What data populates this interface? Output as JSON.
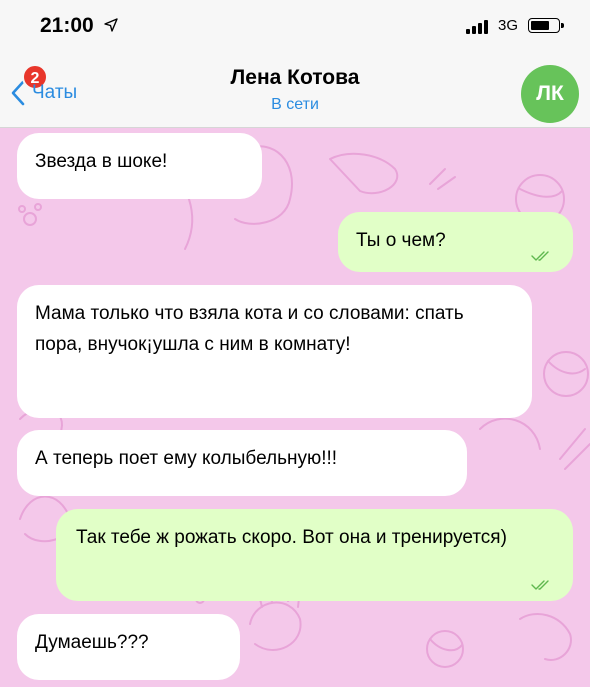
{
  "status_bar": {
    "time": "21:00",
    "network": "3G"
  },
  "nav": {
    "back_label": "Чаты",
    "unread_badge": "2",
    "title": "Лена Котова",
    "status": "В сети",
    "avatar_initials": "ЛК",
    "avatar_color": "#67c35a",
    "accent_color": "#2b8ce0"
  },
  "messages": [
    {
      "direction": "incoming",
      "text": "Звезда в шоке!"
    },
    {
      "direction": "outgoing",
      "text": "Ты о чем?",
      "read": true
    },
    {
      "direction": "incoming",
      "text": "Мама только что взяла кота и со словами: спать пора, внучок¡ушла с ним в комнату!"
    },
    {
      "direction": "incoming",
      "text": "А теперь поет ему колыбельную!!!"
    },
    {
      "direction": "outgoing",
      "text": "Так тебе ж рожать скоро. Вот она и тренируется)",
      "read": true
    },
    {
      "direction": "incoming",
      "text": "Думаешь???"
    }
  ],
  "colors": {
    "chat_background": "#f4c8ea",
    "incoming_bubble": "#ffffff",
    "outgoing_bubble": "#e1ffc7",
    "read_check": "#5fb84f"
  }
}
